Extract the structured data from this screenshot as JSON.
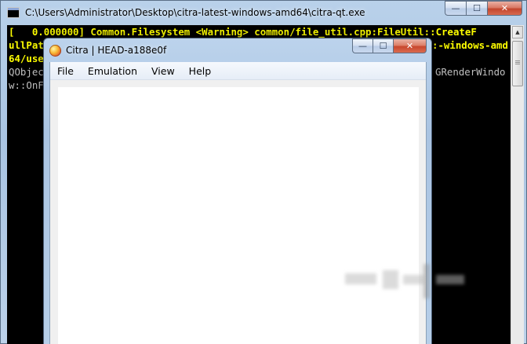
{
  "console_window": {
    "title": "C:\\Users\\Administrator\\Desktop\\citra-latest-windows-amd64\\citra-qt.exe",
    "caption_buttons": {
      "minimize": "—",
      "maximize": "☐",
      "close": "✕"
    },
    "lines": [
      {
        "text": "[   0.000000] Common.Filesystem <Warning> common/file_util.cpp:FileUtil::CreateF",
        "color": "#ffff00"
      },
      {
        "text": "ullPat",
        "color": "#ffff00"
      },
      {
        "text": "64/use",
        "color": "#ffff00"
      },
      {
        "text": "QObjec",
        "color": "#c0c0c0"
      },
      {
        "text": "w::OnF",
        "color": "#c0c0c0"
      }
    ],
    "right_fragments": [
      {
        "text": ":-windows-amd",
        "color": "#ffff00"
      },
      {
        "text": "GRenderWindo",
        "color": "#c0c0c0"
      }
    ],
    "scrollbar_up_arrow": "▲"
  },
  "citra_window": {
    "title": "Citra | HEAD-a188e0f",
    "caption_buttons": {
      "minimize": "—",
      "maximize": "☐",
      "close": "✕"
    },
    "menu": {
      "file": "File",
      "emulation": "Emulation",
      "view": "View",
      "help": "Help"
    }
  },
  "colors": {
    "console_background": "#000000",
    "console_warning_text": "#ffff00",
    "console_info_text": "#c0c0c0",
    "render_area": "#ffffff",
    "close_button": "#c8472d"
  }
}
